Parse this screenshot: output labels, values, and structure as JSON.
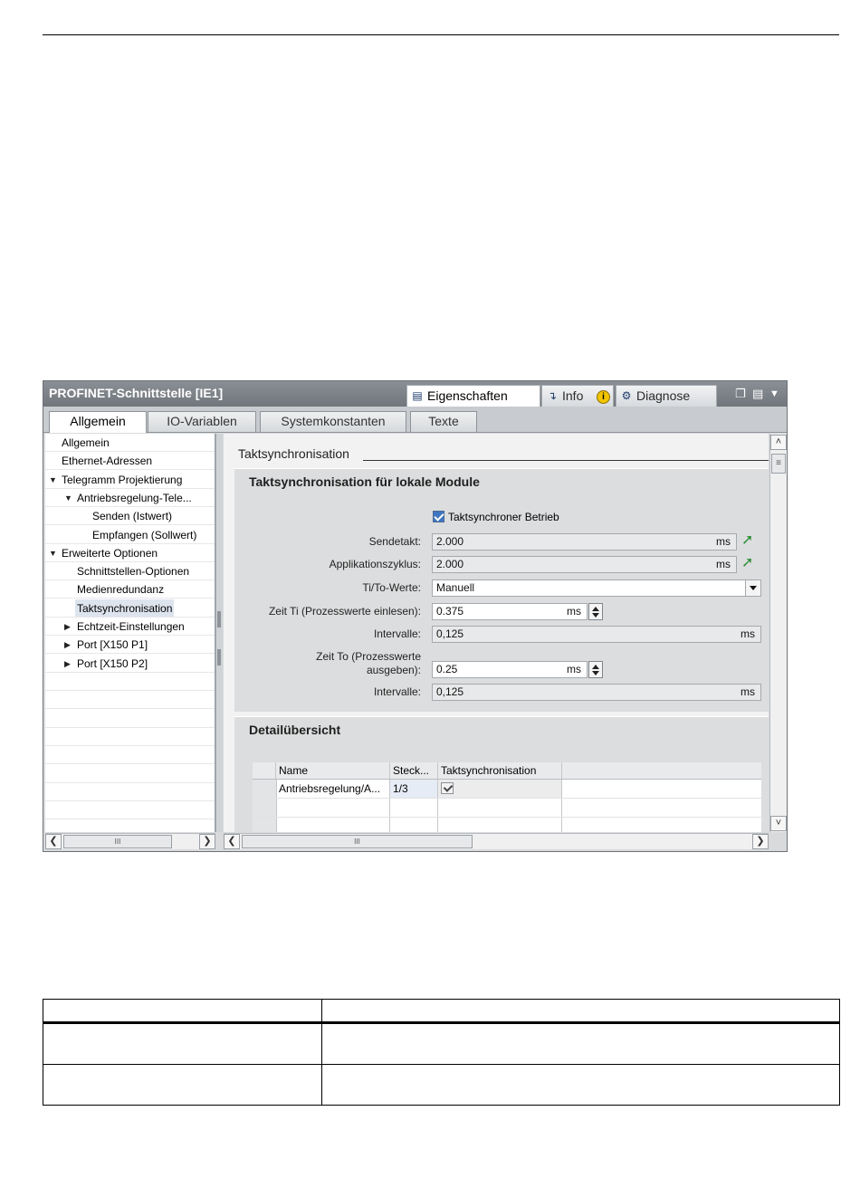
{
  "window": {
    "title": "PROFINET-Schnittstelle [IE1]",
    "top_tabs": [
      {
        "label": "Eigenschaften",
        "icon": "properties-icon"
      },
      {
        "label": "Info",
        "icon": "info-icon"
      },
      {
        "label": "Diagnose",
        "icon": "diagnose-icon"
      }
    ],
    "info_badge": "i",
    "section_tabs": [
      "Allgemein",
      "IO-Variablen",
      "Systemkonstanten",
      "Texte"
    ]
  },
  "tree": [
    {
      "label": "Allgemein",
      "level": 0,
      "arrow": ""
    },
    {
      "label": "Ethernet-Adressen",
      "level": 0,
      "arrow": ""
    },
    {
      "label": "Telegramm Projektierung",
      "level": 0,
      "arrow": "down"
    },
    {
      "label": "Antriebsregelung-Tele...",
      "level": 1,
      "arrow": "down"
    },
    {
      "label": "Senden (Istwert)",
      "level": 2,
      "arrow": ""
    },
    {
      "label": "Empfangen (Sollwert)",
      "level": 2,
      "arrow": ""
    },
    {
      "label": "Erweiterte Optionen",
      "level": 0,
      "arrow": "down"
    },
    {
      "label": "Schnittstellen-Optionen",
      "level": 1,
      "arrow": ""
    },
    {
      "label": "Medienredundanz",
      "level": 1,
      "arrow": ""
    },
    {
      "label": "Taktsynchronisation",
      "level": 1,
      "arrow": "",
      "selected": true
    },
    {
      "label": "Echtzeit-Einstellungen",
      "level": 1,
      "arrow": "right"
    },
    {
      "label": "Port [X150 P1]",
      "level": 1,
      "arrow": "right"
    },
    {
      "label": "Port [X150 P2]",
      "level": 1,
      "arrow": "right"
    }
  ],
  "content": {
    "section_title": "Taktsynchronisation",
    "group1": {
      "title": "Taktsynchronisation für lokale Module",
      "checkbox_label": "Taktsynchroner Betrieb",
      "checkbox_checked": true,
      "fields": {
        "sendetakt": {
          "label": "Sendetakt:",
          "value": "2.000",
          "unit": "ms"
        },
        "applikationszyklus": {
          "label": "Applikationszyklus:",
          "value": "2.000",
          "unit": "ms"
        },
        "ti_to": {
          "label": "Ti/To-Werte:",
          "value": "Manuell"
        },
        "zeit_ti": {
          "label": "Zeit Ti (Prozesswerte einlesen):",
          "value": "0.375",
          "unit": "ms"
        },
        "intervalle1": {
          "label": "Intervalle:",
          "value": "0,125",
          "unit": "ms"
        },
        "zeit_to_line1": "Zeit To (Prozesswerte",
        "zeit_to_line2": "ausgeben):",
        "zeit_to": {
          "value": "0.25",
          "unit": "ms"
        },
        "intervalle2": {
          "label": "Intervalle:",
          "value": "0,125",
          "unit": "ms"
        }
      }
    },
    "group2": {
      "title": "Detailübersicht",
      "columns": [
        "Name",
        "Steck...",
        "Taktsynchronisation"
      ],
      "rows": [
        {
          "name": "Antriebsregelung/A...",
          "steck": "1/3",
          "takt": true
        }
      ]
    }
  },
  "scroll": {
    "thumb_glyph": "III"
  }
}
